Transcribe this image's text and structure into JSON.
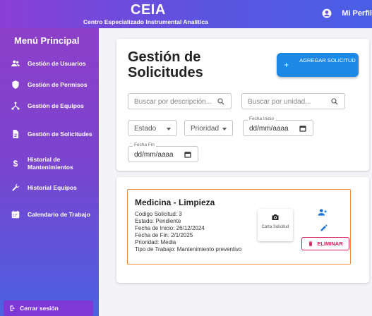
{
  "header": {
    "title": "CEIA",
    "subtitle": "Centro Especializado Instrumental Analítica",
    "profile_label": "Mi Perfil"
  },
  "sidebar": {
    "title": "Menú Principal",
    "items": [
      {
        "label": "Gestión de Usuarios",
        "icon": "users-icon"
      },
      {
        "label": "Gestión de Permisos",
        "icon": "shield-icon"
      },
      {
        "label": "Gestión de Equipos",
        "icon": "network-icon"
      },
      {
        "label": "Gestión de Solicitudes",
        "icon": "document-icon"
      },
      {
        "label": "Historial de Mantenimientos",
        "icon": "dollar-icon"
      },
      {
        "label": "Historial Equipos",
        "icon": "wrench-icon"
      },
      {
        "label": "Calendario de Trabajo",
        "icon": "calendar-icon"
      }
    ],
    "logout_label": "Cerrar sesión"
  },
  "main": {
    "page_title": "Gestión de Solicitudes",
    "add_button": "AGREGAR SOLICITUD",
    "filters": {
      "search_desc_placeholder": "Buscar por descripción...",
      "search_unit_placeholder": "Buscar por unidad...",
      "estado_label": "Estado",
      "prioridad_label": "Prioridad",
      "fecha_inicio_legend": "Fecha Inicio",
      "fecha_inicio_value": "dd/mm/aaaa",
      "fecha_fin_legend": "Fecha Fin",
      "fecha_fin_value": "dd/mm/aaaa"
    },
    "request": {
      "title": "Medicina - Limpieza",
      "lines": [
        "Codigo Solicitud: 3",
        "Estado: Pendiente",
        "Fecha de Inicio: 26/12/2024",
        "Fecha de Fin: 2/1/2025",
        "Prioridad: Media",
        "Tipo de Trabajo: Mantenimiento preventivo"
      ],
      "photo_label": "Carta Solicitud",
      "delete_label": "ELIMINAR"
    }
  },
  "colors": {
    "accent_blue": "#1e88e5",
    "delete_pink": "#d81b60",
    "request_border": "#f08a3c",
    "sidebar_purple": "#8d3fc8"
  }
}
